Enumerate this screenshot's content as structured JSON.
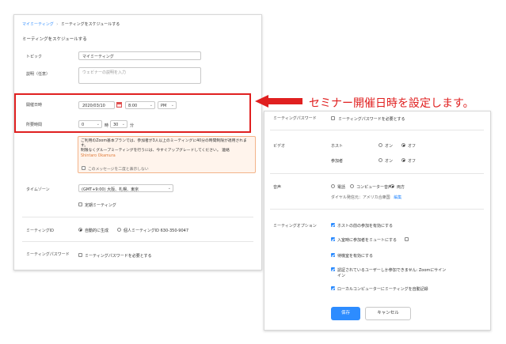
{
  "breadcrumb": {
    "parent": "マイミーティング",
    "separator": "›",
    "current": "ミーティングをスケジュールする"
  },
  "page_title": "ミーティングをスケジュールする",
  "topic": {
    "label": "トピック",
    "value": "マイミーティング"
  },
  "description": {
    "label": "説明（任意）",
    "placeholder": "ウェビナーの説明を入力"
  },
  "when": {
    "label": "開催日時",
    "date": "2020/03/10",
    "time": "8:00",
    "ampm": "PM"
  },
  "duration": {
    "label": "所要時間",
    "hours": "0",
    "hours_unit": "時",
    "minutes": "30",
    "minutes_unit": "分"
  },
  "notice": {
    "text": "ご利用のZoom基本プランでは、参加者が3人以上のミーティングに40分の時間制限が適用されます。",
    "text2": "制限なくグループミーティングを行うには、今すぐアップグレードしてください。 連絡",
    "name": "Shintaro Okamura",
    "dismiss": "このメッセージを二度と表示しない"
  },
  "timezone": {
    "label": "タイムゾーン",
    "value": "(GMT+9:00) 大阪、札幌、東京"
  },
  "recurring": {
    "label": "定期ミーティング"
  },
  "meeting_id": {
    "label": "ミーティングID",
    "option_auto": "自動的に生成",
    "option_personal": "個人ミーティングID 630-350-9047"
  },
  "meeting_password": {
    "label": "ミーティングパスワード",
    "option": "ミーティングパスワードを必要とする"
  },
  "annotation": {
    "text": "セミナー開催日時を設定します。",
    "color": "#e02020"
  },
  "right": {
    "password_label": "ミーティングパスワード",
    "password_option": "ミーティングパスワードを必要とする",
    "video_label": "ビデオ",
    "host_label": "ホスト",
    "participants_label": "参加者",
    "on": "オン",
    "off": "オフ",
    "audio_label": "音声",
    "audio_phone": "電話",
    "audio_computer": "コンピューター音声",
    "audio_both": "両方",
    "dialin_text": "ダイヤル発信元：アメリカ合衆国",
    "dialin_edit": "編集",
    "options_label": "ミーティングオプション",
    "options": [
      "ホストの前の参加を有効にする",
      "入室時に参加者をミュートにする",
      "待機室を有効にする",
      "認証されているユーザーしか参加できません: Zoomにサイン",
      "ローカルコンピューターにミーティングを自動記録"
    ],
    "option_auth_line2": "イン",
    "save_label": "保存",
    "cancel_label": "キャンセル",
    "accent": "#2d8cff"
  }
}
